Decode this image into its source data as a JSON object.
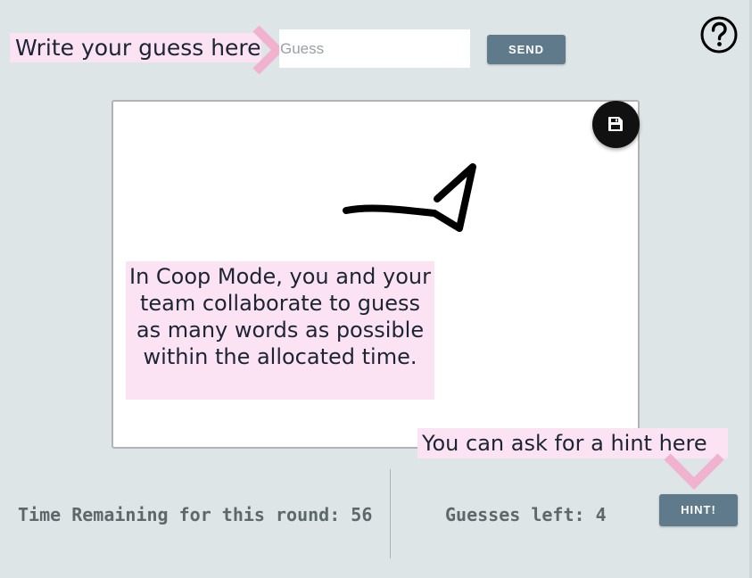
{
  "guess": {
    "tooltip": "Write your guess here",
    "placeholder": "Guess",
    "value": "",
    "send_label": "SEND"
  },
  "help": {
    "icon": "question-circle-icon"
  },
  "canvas": {
    "save_icon": "floppy-disk-icon",
    "tooltip": "In Coop Mode, you and your team collaborate to guess as many words as possible within the allocated time."
  },
  "hint": {
    "tooltip": "You can ask for a hint here",
    "button_label": "HINT!"
  },
  "status": {
    "time_label": "Time Remaining for this round:",
    "time_value": "56",
    "guesses_label": "Guesses left:",
    "guesses_value": "4"
  },
  "colors": {
    "background": "#dde5e7",
    "button": "#5f7a8a",
    "tooltip_bg": "#fbe3f3",
    "arrow": "#f0b2cf",
    "stroke": "#000000"
  }
}
